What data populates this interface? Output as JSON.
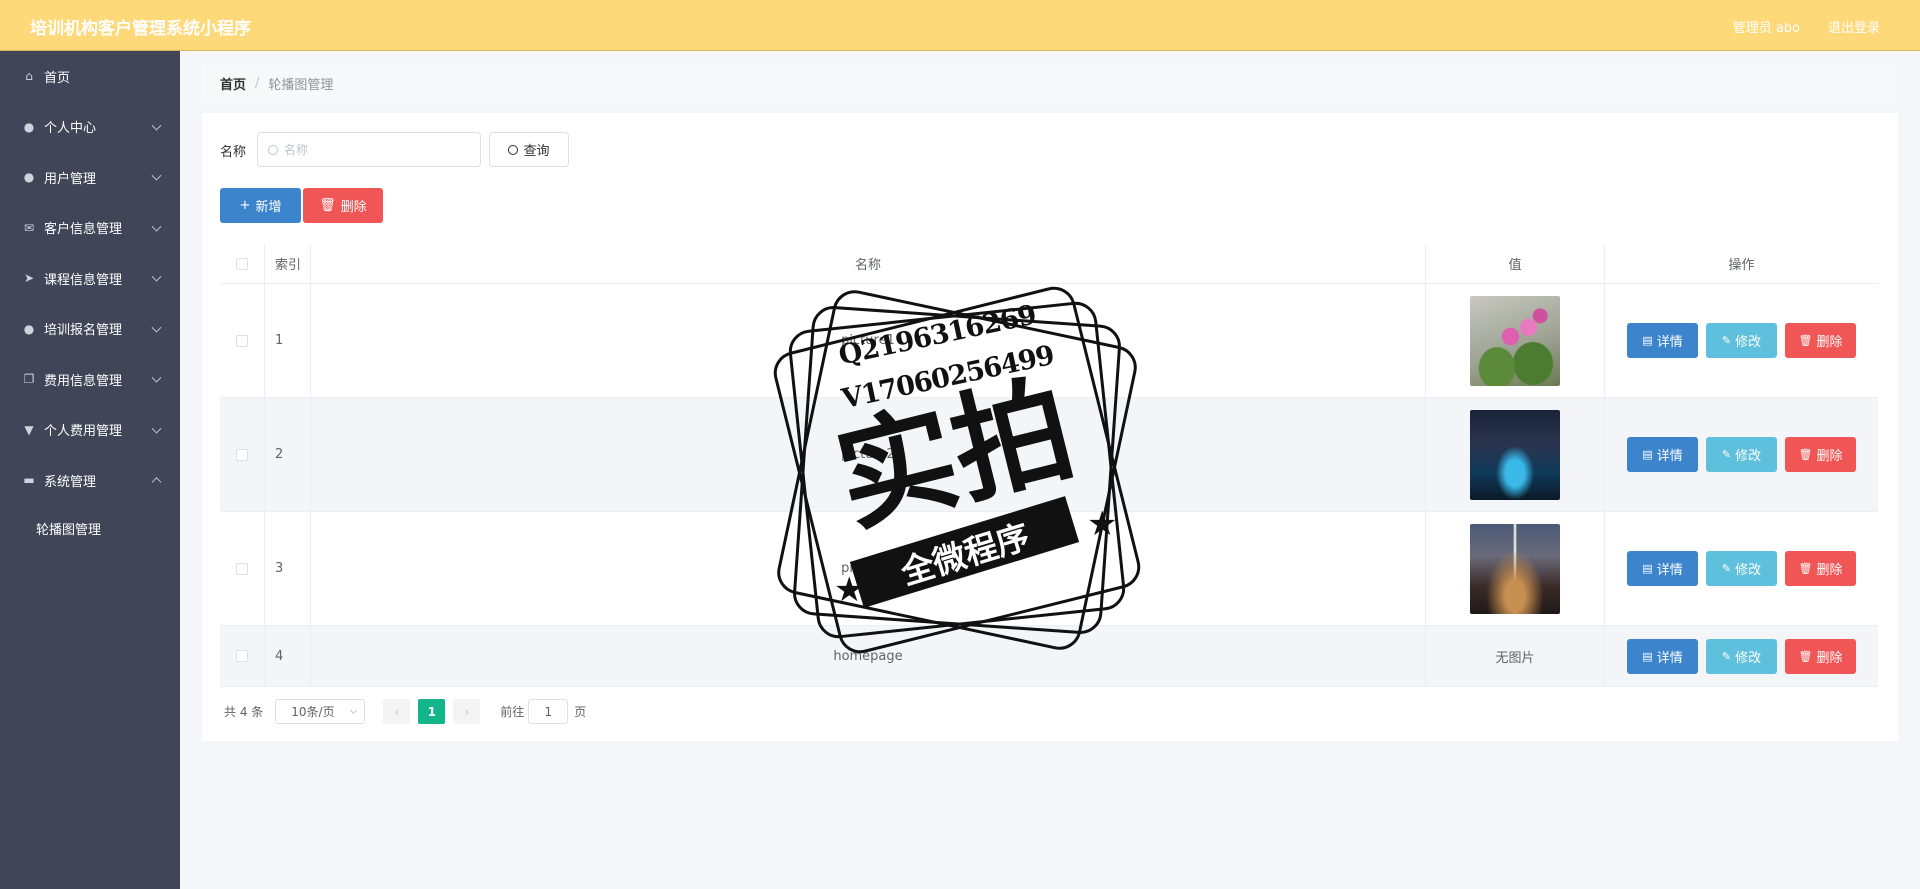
{
  "header": {
    "title": "培训机构客户管理系统小程序",
    "user": "管理员 abo",
    "logout": "退出登录"
  },
  "sidebar": {
    "items": [
      {
        "label": "首页",
        "icon": "home-icon"
      },
      {
        "label": "个人中心",
        "icon": "user-icon"
      },
      {
        "label": "用户管理",
        "icon": "user-icon"
      },
      {
        "label": "客户信息管理",
        "icon": "mail-icon"
      },
      {
        "label": "课程信息管理",
        "icon": "send-icon"
      },
      {
        "label": "培训报名管理",
        "icon": "user-icon"
      },
      {
        "label": "费用信息管理",
        "icon": "copy-icon"
      },
      {
        "label": "个人费用管理",
        "icon": "cup-icon"
      },
      {
        "label": "系统管理",
        "icon": "monitor-icon"
      }
    ],
    "sub_item": "轮播图管理"
  },
  "breadcrumb": {
    "home": "首页",
    "separator": "/",
    "current": "轮播图管理"
  },
  "search": {
    "label": "名称",
    "placeholder": "名称",
    "button": "查询"
  },
  "actions": {
    "add": "新增",
    "delete": "删除"
  },
  "table": {
    "headers": {
      "index": "索引",
      "name": "名称",
      "value": "值",
      "ops": "操作"
    },
    "rows": [
      {
        "index": "1",
        "name": "picture1",
        "value": "image"
      },
      {
        "index": "2",
        "name": "picture2",
        "value": "image"
      },
      {
        "index": "3",
        "name": "picture3",
        "value": "image"
      },
      {
        "index": "4",
        "name": "homepage",
        "value": "无图片"
      }
    ],
    "op_labels": {
      "detail": "详情",
      "edit": "修改",
      "delete": "删除"
    }
  },
  "pagination": {
    "total": "共 4 条",
    "page_size": "10条/页",
    "current": "1",
    "goto_label": "前往",
    "goto_value": "1",
    "page_suffix": "页"
  },
  "watermark": {
    "line1": "Q2196316269",
    "line2": "V17060256499",
    "big": "实拍",
    "ribbon": "全微程序"
  },
  "colors": {
    "header": "#fdd97a",
    "sidebar": "#404658",
    "primary": "#3c84cb",
    "danger": "#f05656",
    "info": "#5ec0dc",
    "pager_active": "#13b58a"
  }
}
